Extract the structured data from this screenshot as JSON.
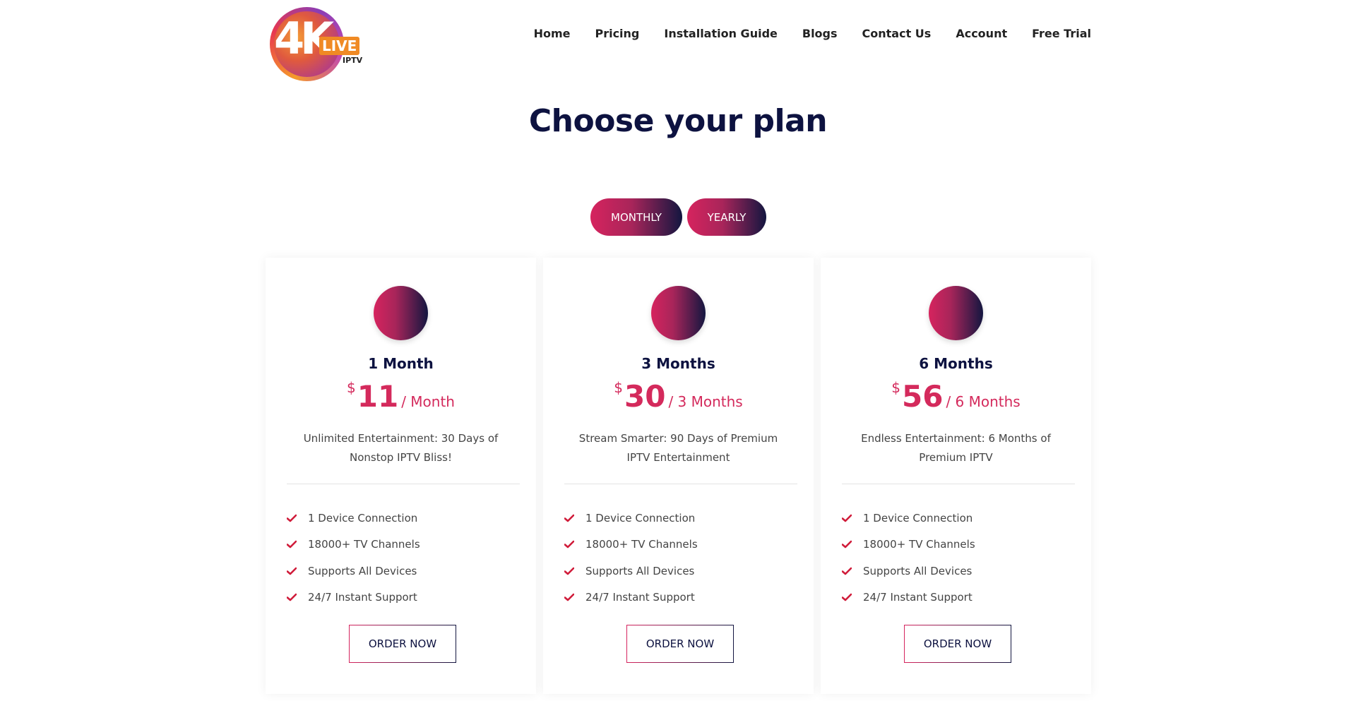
{
  "logo": {
    "mark": "4K",
    "badge": "LIVE",
    "sub": "IPTV"
  },
  "nav": {
    "items": [
      {
        "label": "Home"
      },
      {
        "label": "Pricing"
      },
      {
        "label": "Installation Guide"
      },
      {
        "label": "Blogs"
      },
      {
        "label": "Contact Us"
      },
      {
        "label": "Account"
      },
      {
        "label": "Free Trial"
      }
    ]
  },
  "title": "Choose your plan",
  "toggle": {
    "monthly": "MONTHLY",
    "yearly": "YEARLY"
  },
  "plans": [
    {
      "name": "1 Month",
      "currency": "$",
      "amount": "11",
      "period": "/ Month",
      "description": "Unlimited Entertainment: 30 Days of Nonstop IPTV Bliss!",
      "features": [
        "1 Device Connection",
        "18000+ TV Channels",
        "Supports All Devices",
        "24/7 Instant Support"
      ],
      "cta": "ORDER NOW"
    },
    {
      "name": "3 Months",
      "currency": "$",
      "amount": "30",
      "period": "/ 3 Months",
      "description": "Stream Smarter: 90 Days of Premium IPTV Entertainment",
      "features": [
        "1 Device Connection",
        "18000+ TV Channels",
        "Supports All Devices",
        "24/7 Instant Support"
      ],
      "cta": "ORDER NOW"
    },
    {
      "name": "6 Months",
      "currency": "$",
      "amount": "56",
      "period": "/ 6 Months",
      "description": "Endless Entertainment: 6 Months of Premium IPTV",
      "features": [
        "1 Device Connection",
        "18000+ TV Channels",
        "Supports All Devices",
        "24/7 Instant Support"
      ],
      "cta": "ORDER NOW"
    }
  ],
  "colors": {
    "accent": "#d6245e",
    "navy": "#0d1240",
    "check": "#d01c3a"
  },
  "icons": {
    "feature": "check-icon",
    "plan": "plan-circle-icon"
  }
}
